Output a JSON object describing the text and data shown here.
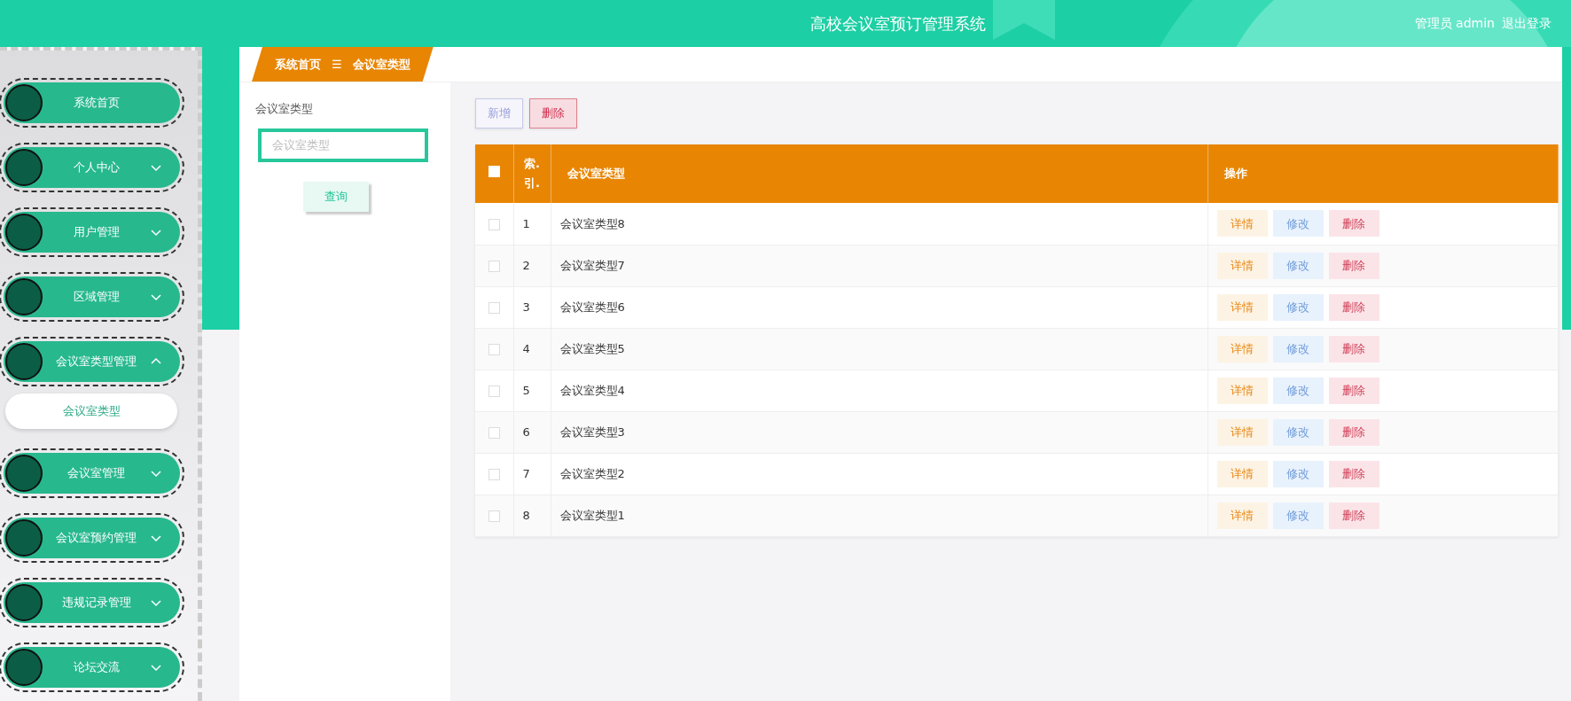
{
  "header": {
    "title": "高校会议室预订管理系统",
    "user": "管理员 admin",
    "logout": "退出登录"
  },
  "sidebar": {
    "items": [
      {
        "label": "系统首页",
        "kind": "link"
      },
      {
        "label": "个人中心",
        "kind": "menu",
        "expanded": false
      },
      {
        "label": "用户管理",
        "kind": "menu",
        "expanded": false
      },
      {
        "label": "区域管理",
        "kind": "menu",
        "expanded": false
      },
      {
        "label": "会议室类型管理",
        "kind": "menu",
        "expanded": true,
        "children": [
          {
            "label": "会议室类型"
          }
        ]
      },
      {
        "label": "会议室管理",
        "kind": "menu",
        "expanded": false
      },
      {
        "label": "会议室预约管理",
        "kind": "menu",
        "expanded": false
      },
      {
        "label": "违规记录管理",
        "kind": "menu",
        "expanded": false
      },
      {
        "label": "论坛交流",
        "kind": "menu",
        "expanded": false
      }
    ]
  },
  "breadcrumb": {
    "items": [
      "系统首页",
      "会议室类型"
    ],
    "separator": "☰"
  },
  "filter": {
    "label": "会议室类型",
    "placeholder": "会议室类型",
    "button": "查询"
  },
  "toolbar": [
    {
      "label": "新增",
      "kind": "add"
    },
    {
      "label": "删除",
      "kind": "delete"
    }
  ],
  "table": {
    "columns": [
      "索.引.",
      "会议室类型",
      "操作"
    ],
    "header_checkbox": {
      "checked": false
    },
    "rows": [
      {
        "checked": false,
        "index": "1",
        "type": "会议室类型8",
        "actions": [
          {
            "label": "详情",
            "kind": "detail"
          },
          {
            "label": "修改",
            "kind": "edit"
          },
          {
            "label": "删除",
            "kind": "delete"
          }
        ]
      },
      {
        "checked": false,
        "index": "2",
        "type": "会议室类型7",
        "actions": [
          {
            "label": "详情",
            "kind": "detail"
          },
          {
            "label": "修改",
            "kind": "edit"
          },
          {
            "label": "删除",
            "kind": "delete"
          }
        ]
      },
      {
        "checked": false,
        "index": "3",
        "type": "会议室类型6",
        "actions": [
          {
            "label": "详情",
            "kind": "detail"
          },
          {
            "label": "修改",
            "kind": "edit"
          },
          {
            "label": "删除",
            "kind": "delete"
          }
        ]
      },
      {
        "checked": false,
        "index": "4",
        "type": "会议室类型5",
        "actions": [
          {
            "label": "详情",
            "kind": "detail"
          },
          {
            "label": "修改",
            "kind": "edit"
          },
          {
            "label": "删除",
            "kind": "delete"
          }
        ]
      },
      {
        "checked": false,
        "index": "5",
        "type": "会议室类型4",
        "actions": [
          {
            "label": "详情",
            "kind": "detail"
          },
          {
            "label": "修改",
            "kind": "edit"
          },
          {
            "label": "删除",
            "kind": "delete"
          }
        ]
      },
      {
        "checked": false,
        "index": "6",
        "type": "会议室类型3",
        "actions": [
          {
            "label": "详情",
            "kind": "detail"
          },
          {
            "label": "修改",
            "kind": "edit"
          },
          {
            "label": "删除",
            "kind": "delete"
          }
        ]
      },
      {
        "checked": false,
        "index": "7",
        "type": "会议室类型2",
        "actions": [
          {
            "label": "详情",
            "kind": "detail"
          },
          {
            "label": "修改",
            "kind": "edit"
          },
          {
            "label": "删除",
            "kind": "delete"
          }
        ]
      },
      {
        "checked": false,
        "index": "8",
        "type": "会议室类型1",
        "actions": [
          {
            "label": "详情",
            "kind": "detail"
          },
          {
            "label": "修改",
            "kind": "edit"
          },
          {
            "label": "删除",
            "kind": "delete"
          }
        ]
      }
    ]
  }
}
